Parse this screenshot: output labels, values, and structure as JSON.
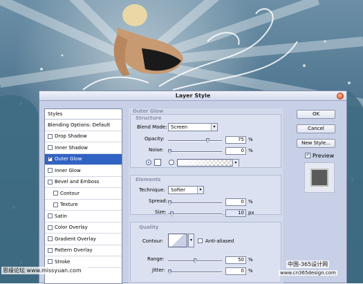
{
  "dialog": {
    "title": "Layer Style"
  },
  "styles_panel": {
    "header": "Styles",
    "items": [
      {
        "label": "Blending Options: Default",
        "checkbox": false,
        "checked": false,
        "selected": false,
        "indent": false
      },
      {
        "label": "Drop Shadow",
        "checkbox": true,
        "checked": false,
        "selected": false,
        "indent": false
      },
      {
        "label": "Inner Shadow",
        "checkbox": true,
        "checked": false,
        "selected": false,
        "indent": false
      },
      {
        "label": "Outer Glow",
        "checkbox": true,
        "checked": true,
        "selected": true,
        "indent": false
      },
      {
        "label": "Inner Glow",
        "checkbox": true,
        "checked": false,
        "selected": false,
        "indent": false
      },
      {
        "label": "Bevel and Emboss",
        "checkbox": true,
        "checked": false,
        "selected": false,
        "indent": false
      },
      {
        "label": "Contour",
        "checkbox": true,
        "checked": false,
        "selected": false,
        "indent": true
      },
      {
        "label": "Texture",
        "checkbox": true,
        "checked": false,
        "selected": false,
        "indent": true
      },
      {
        "label": "Satin",
        "checkbox": true,
        "checked": false,
        "selected": false,
        "indent": false
      },
      {
        "label": "Color Overlay",
        "checkbox": true,
        "checked": false,
        "selected": false,
        "indent": false
      },
      {
        "label": "Gradient Overlay",
        "checkbox": true,
        "checked": false,
        "selected": false,
        "indent": false
      },
      {
        "label": "Pattern Overlay",
        "checkbox": true,
        "checked": false,
        "selected": false,
        "indent": false
      },
      {
        "label": "Stroke",
        "checkbox": true,
        "checked": false,
        "selected": false,
        "indent": false
      }
    ]
  },
  "outer_glow": {
    "section_title": "Outer Glow",
    "structure": {
      "title": "Structure",
      "blend_mode_label": "Blend Mode:",
      "blend_mode_value": "Screen",
      "opacity_label": "Opacity:",
      "opacity_value": "75",
      "opacity_level": 0.75,
      "noise_label": "Noise:",
      "noise_value": "0",
      "noise_level": 0,
      "percent": "%"
    },
    "elements": {
      "title": "Elements",
      "technique_label": "Technique:",
      "technique_value": "Softer",
      "spread_label": "Spread:",
      "spread_value": "0",
      "spread_level": 0,
      "size_label": "Size:",
      "size_value": "10",
      "size_level": 0.04,
      "percent": "%",
      "px": "px"
    },
    "quality": {
      "title": "Quality",
      "contour_label": "Contour:",
      "anti_aliased_label": "Anti-aliased",
      "range_label": "Range:",
      "range_value": "50",
      "range_level": 0.5,
      "jitter_label": "Jitter:",
      "jitter_value": "0",
      "jitter_level": 0,
      "percent": "%"
    }
  },
  "buttons": {
    "ok": "OK",
    "cancel": "Cancel",
    "new_style": "New Style...",
    "preview_label": "Preview",
    "preview_checked": true
  },
  "watermarks": {
    "left": "思缘论坛 www.missyuan.com",
    "right_line1": "中国-365设计网",
    "right_line2": "www.cn365design.com"
  },
  "colors": {
    "selection": "#3163c5",
    "dialog_bg": "#c7d0e6"
  }
}
